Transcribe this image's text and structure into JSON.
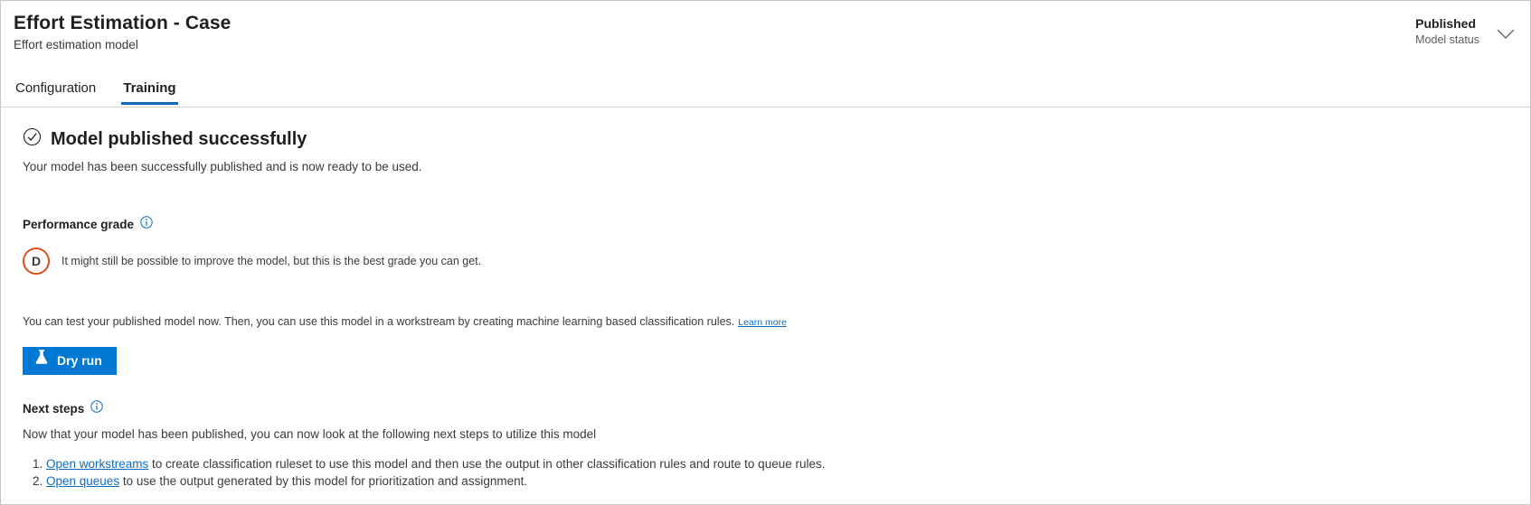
{
  "header": {
    "title": "Effort Estimation - Case",
    "subtitle": "Effort estimation model",
    "status_value": "Published",
    "status_label": "Model status",
    "chevron_icon": "chevron-down-icon"
  },
  "tabs": [
    {
      "label": "Configuration",
      "active": false
    },
    {
      "label": "Training",
      "active": true
    }
  ],
  "banner": {
    "icon": "check-circle-icon",
    "title": "Model published successfully",
    "description": "Your model has been successfully published and is now ready to be used."
  },
  "performance_grade": {
    "label": "Performance grade",
    "info_icon": "info-icon",
    "grade": "D",
    "grade_color": "#d94f1e",
    "description": "It might still be possible to improve the model, but this is the best grade you can get."
  },
  "test_model": {
    "text": "You can test your published model now. Then, you can use this model in a workstream by creating machine learning based classification rules.",
    "learn_more": "Learn more",
    "button_label": "Dry run",
    "button_icon": "flask-icon",
    "button_color": "#0078d4"
  },
  "next_steps": {
    "label": "Next steps",
    "info_icon": "info-icon",
    "description": "Now that your model has been published, you can now look at the following next steps to utilize this model",
    "items": [
      {
        "link": "Open workstreams",
        "text": " to create classification ruleset to use this model and then use the output in other classification rules and route to queue rules."
      },
      {
        "link": "Open queues",
        "text": " to use the output generated by this model for prioritization and assignment."
      }
    ]
  },
  "colors": {
    "accent": "#0078d4",
    "link": "#0f6cbd",
    "grade": "#d94f1e"
  }
}
